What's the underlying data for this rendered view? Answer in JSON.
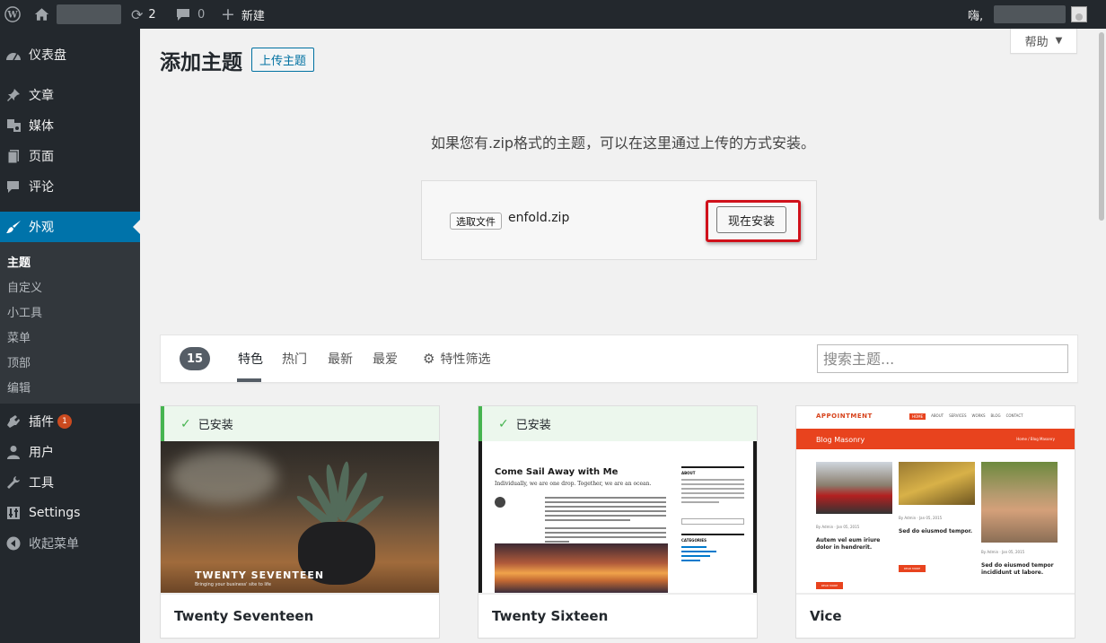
{
  "adminbar": {
    "updates_count": "2",
    "comments_count": "0",
    "new_label": "新建",
    "greeting": "嗨,"
  },
  "sidebar": {
    "items": [
      {
        "label": "仪表盘",
        "icon": "dashboard-icon"
      },
      {
        "label": "文章",
        "icon": "pin-icon"
      },
      {
        "label": "媒体",
        "icon": "media-icon"
      },
      {
        "label": "页面",
        "icon": "page-icon"
      },
      {
        "label": "评论",
        "icon": "comment-icon"
      },
      {
        "label": "外观",
        "icon": "brush-icon"
      },
      {
        "label": "插件",
        "icon": "plugin-icon",
        "badge": "1"
      },
      {
        "label": "用户",
        "icon": "user-icon"
      },
      {
        "label": "工具",
        "icon": "wrench-icon"
      },
      {
        "label": "Settings",
        "icon": "settings-icon"
      },
      {
        "label": "收起菜单",
        "icon": "collapse-icon"
      }
    ],
    "submenu": [
      "主题",
      "自定义",
      "小工具",
      "菜单",
      "顶部",
      "编辑"
    ]
  },
  "help_label": "帮助",
  "page": {
    "title": "添加主题",
    "upload_button": "上传主题",
    "upload_help": "如果您有.zip格式的主题，可以在这里通过上传的方式安装。",
    "choose_file": "选取文件",
    "file_name": "enfold.zip",
    "install_now": "现在安装"
  },
  "filter": {
    "count": "15",
    "tabs": [
      "特色",
      "热门",
      "最新",
      "最爱"
    ],
    "feature_filter": "特性筛选",
    "search_placeholder": "搜索主题..."
  },
  "themes": [
    {
      "name": "Twenty Seventeen",
      "installed": "已安装",
      "shot_title": "TWENTY SEVENTEEN",
      "shot_tagline": "Bringing your business' site to life"
    },
    {
      "name": "Twenty Sixteen",
      "installed": "已安装",
      "shot_title": "Come Sail Away with Me",
      "shot_subtitle": "Individually, we are one drop. Together, we are an ocean.",
      "shot_about": "ABOUT",
      "shot_categories": "CATEGORIES"
    },
    {
      "name": "Vice",
      "shot_logo": "APPOINTMENT",
      "shot_banner": "Blog Masonry",
      "shot_crumb": "Home / Blog Masonry",
      "shot_nav": [
        "HOME",
        "ABOUT",
        "SERVICES",
        "WORKS",
        "BLOG",
        "CONTACT"
      ],
      "shot_posts": [
        "Autem vel eum iriure dolor in hendrerit.",
        "Sed do eiusmod tempor.",
        "Sed do eiusmod tempor incididunt ut labore."
      ],
      "shot_more": "READ MORE"
    }
  ],
  "colors": {
    "adminbar_bg": "#23282d",
    "accent": "#0073aa",
    "highlight_red": "#d0111b",
    "installed_green": "#46b450"
  }
}
